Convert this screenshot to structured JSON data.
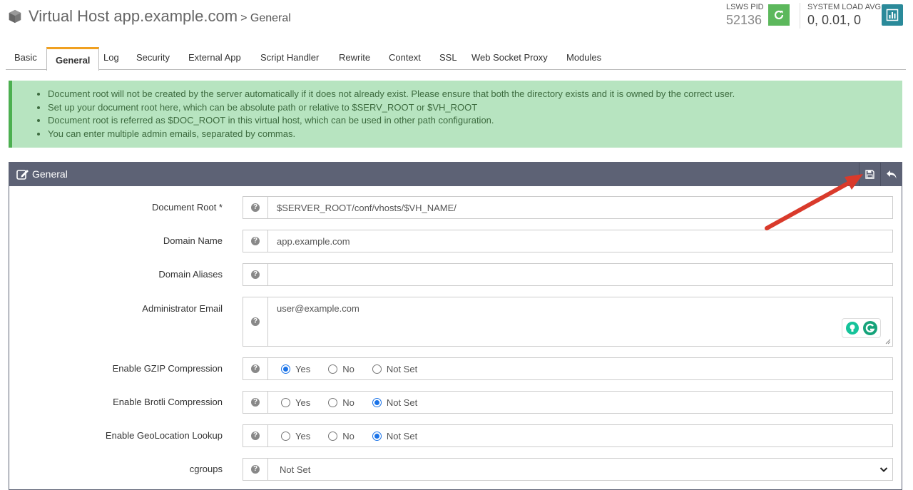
{
  "header": {
    "title": "Virtual Host app.example.com",
    "breadcrumb": "> General",
    "pid_label": "LSWS PID",
    "pid_value": "52136",
    "load_label": "SYSTEM LOAD AVG",
    "load_value": "0, 0.01, 0"
  },
  "tabs": [
    "Basic",
    "General",
    "Log",
    "Security",
    "External App",
    "Script Handler",
    "Rewrite",
    "Context",
    "SSL",
    "Web Socket Proxy",
    "Modules"
  ],
  "active_tab": "General",
  "notes": [
    "Document root will not be created by the server automatically if it does not already exist. Please ensure that both the directory exists and it is owned by the correct user.",
    "Set up your document root here, which can be absolute path or relative to $SERV_ROOT or $VH_ROOT",
    "Document root is referred as $DOC_ROOT in this virtual host, which can be used in other path configuration.",
    "You can enter multiple admin emails, separated by commas."
  ],
  "panel": {
    "title": "General",
    "fields": {
      "document_root": {
        "label": "Document Root *",
        "value": "$SERVER_ROOT/conf/vhosts/$VH_NAME/"
      },
      "domain_name": {
        "label": "Domain Name",
        "value": "app.example.com"
      },
      "domain_aliases": {
        "label": "Domain Aliases",
        "value": ""
      },
      "admin_email": {
        "label": "Administrator Email",
        "value": "user@example.com"
      },
      "gzip": {
        "label": "Enable GZIP Compression",
        "selected": "Yes"
      },
      "brotli": {
        "label": "Enable Brotli Compression",
        "selected": "Not Set"
      },
      "geolocation": {
        "label": "Enable GeoLocation Lookup",
        "selected": "Not Set"
      },
      "cgroups": {
        "label": "cgroups",
        "value": "Not Set"
      }
    },
    "radio_options": [
      "Yes",
      "No",
      "Not Set"
    ]
  },
  "colors": {
    "panel_header": "#5d6275",
    "notes_bg": "#b7e4c0",
    "tab_accent": "#f0a020",
    "restart_btn": "#5cb85c",
    "stats_btn": "#2a8a9a",
    "arrow": "#d93a2b"
  },
  "icons": [
    "cube-icon",
    "refresh-icon",
    "bar-chart-icon",
    "edit-icon",
    "save-icon",
    "undo-icon",
    "question-icon",
    "grammarly-icon",
    "lightbulb-icon"
  ]
}
